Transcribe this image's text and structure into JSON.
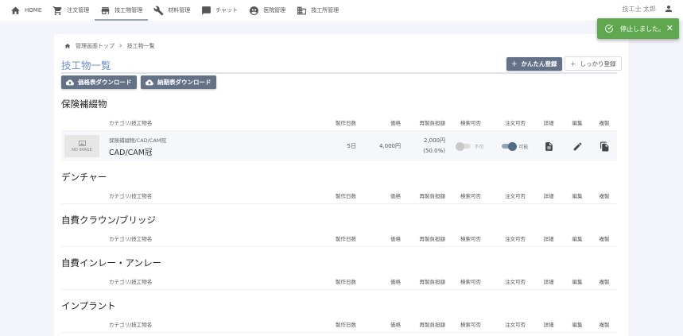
{
  "nav": [
    {
      "label": "HOME",
      "icon": "home-icon"
    },
    {
      "label": "注文管理",
      "icon": "cart-icon"
    },
    {
      "label": "技工物管理",
      "icon": "store-icon",
      "active": true
    },
    {
      "label": "材料管理",
      "icon": "wrench-icon"
    },
    {
      "label": "チャット",
      "icon": "chat-icon"
    },
    {
      "label": "医院管理",
      "icon": "clinic-icon"
    },
    {
      "label": "技工所管理",
      "icon": "building-icon"
    }
  ],
  "user": {
    "name": "技工士 太郎"
  },
  "toast": {
    "message": "停止しました。",
    "close": "✕"
  },
  "breadcrumb": {
    "home": "管理画面トップ",
    "current": "技工物一覧"
  },
  "page": {
    "title": "技工物一覧",
    "easy_register": "かんたん登録",
    "full_register": "しっかり登録",
    "price_download": "価格表ダウンロード",
    "delivery_download": "納期表ダウンロード"
  },
  "columns": {
    "name": "カテゴリ/技工物名",
    "days": "製作日数",
    "price": "価格",
    "remake": "再製負担額",
    "search": "検索可否",
    "order": "注文可否",
    "detail": "詳細",
    "edit": "編集",
    "copy": "複製"
  },
  "sections": [
    {
      "title": "保険補綴物",
      "items": [
        {
          "category": "保険補綴物/CAD/CAM冠",
          "name": "CAD/CAM冠",
          "no_image": "NO IMAGE",
          "days": "5日",
          "price": "4,000円",
          "remake": "2,000円",
          "remake_pct": "(50.0%)",
          "search": false,
          "search_label": "不可",
          "order": true,
          "order_label": "可能"
        }
      ]
    },
    {
      "title": "デンチャー",
      "items": []
    },
    {
      "title": "自費クラウン/ブリッジ",
      "items": []
    },
    {
      "title": "自費インレー・アンレー",
      "items": []
    },
    {
      "title": "インプラント",
      "items": []
    }
  ],
  "colors": {
    "accent": "#6d8fd0",
    "button": "#637287",
    "toast": "#5fa84f",
    "toggle_on": "#546a87"
  }
}
